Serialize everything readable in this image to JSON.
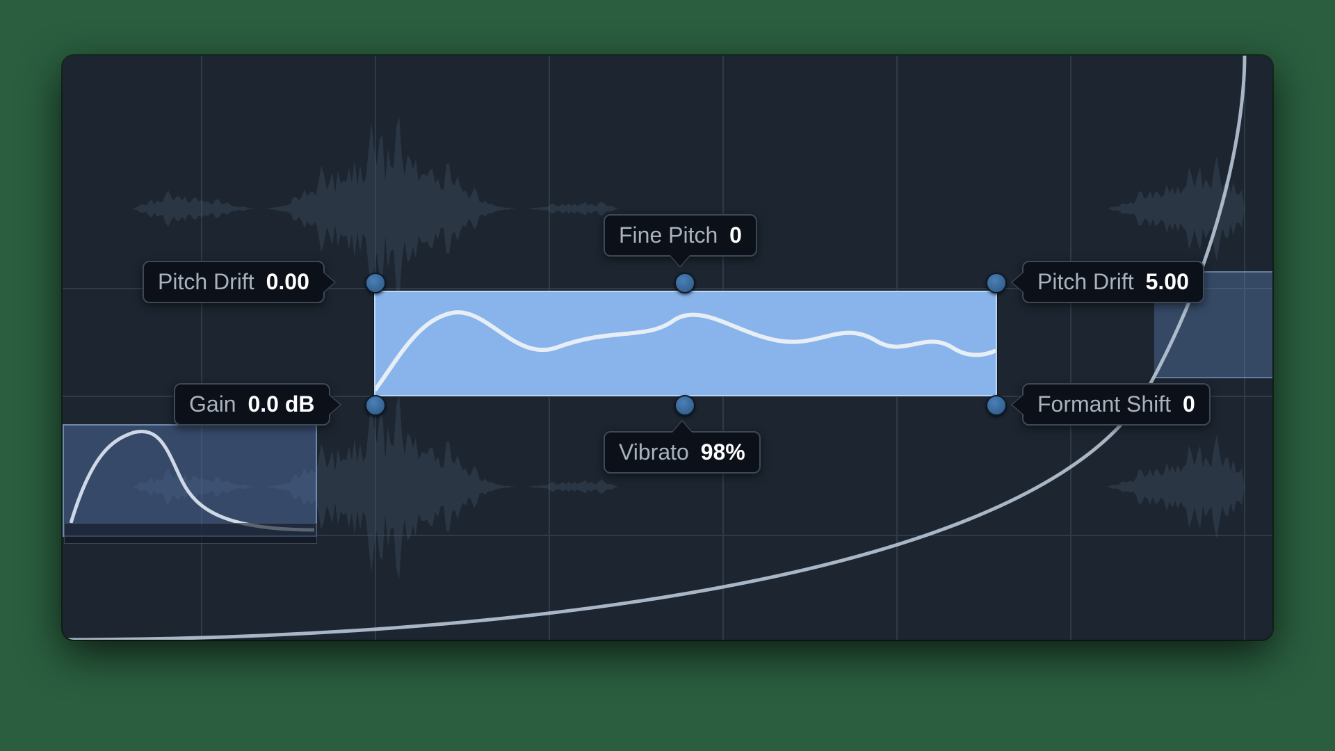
{
  "hotspots": {
    "top_left": {
      "label": "Pitch Drift",
      "value": "0.00"
    },
    "top_center": {
      "label": "Fine Pitch",
      "value": "0"
    },
    "top_right": {
      "label": "Pitch Drift",
      "value": "5.00"
    },
    "bottom_left": {
      "label": "Gain",
      "value": "0.0 dB"
    },
    "bottom_center": {
      "label": "Vibrato",
      "value": "98%"
    },
    "bottom_right": {
      "label": "Formant Shift",
      "value": "0"
    }
  },
  "colors": {
    "selection": "#88b3eb",
    "background": "#1c2530",
    "page_bg": "#2a5e3f"
  }
}
